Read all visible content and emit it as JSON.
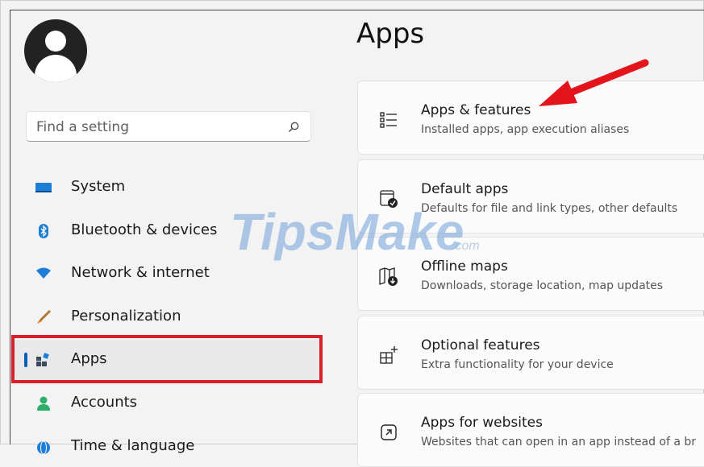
{
  "search": {
    "placeholder": "Find a setting"
  },
  "sidebar": {
    "items": [
      {
        "label": "System",
        "icon": "monitor-icon"
      },
      {
        "label": "Bluetooth & devices",
        "icon": "bluetooth-icon"
      },
      {
        "label": "Network & internet",
        "icon": "wifi-icon"
      },
      {
        "label": "Personalization",
        "icon": "brush-icon"
      },
      {
        "label": "Apps",
        "icon": "apps-icon",
        "selected": true
      },
      {
        "label": "Accounts",
        "icon": "person-icon"
      },
      {
        "label": "Time & language",
        "icon": "globe-icon"
      }
    ]
  },
  "main": {
    "title": "Apps",
    "cards": [
      {
        "title": "Apps & features",
        "subtitle": "Installed apps, app execution aliases",
        "icon": "list-icon"
      },
      {
        "title": "Default apps",
        "subtitle": "Defaults for file and link types, other defaults",
        "icon": "default-apps-icon"
      },
      {
        "title": "Offline maps",
        "subtitle": "Downloads, storage location, map updates",
        "icon": "map-download-icon"
      },
      {
        "title": "Optional features",
        "subtitle": "Extra functionality for your device",
        "icon": "grid-plus-icon"
      },
      {
        "title": "Apps for websites",
        "subtitle": "Websites that can open in an app instead of a br",
        "icon": "open-external-icon"
      }
    ]
  },
  "watermark": {
    "text": "TipsMake",
    "suffix": ".com"
  },
  "colors": {
    "accent": "#005fb8",
    "highlight": "#d9202a",
    "arrow": "#e3141b"
  }
}
